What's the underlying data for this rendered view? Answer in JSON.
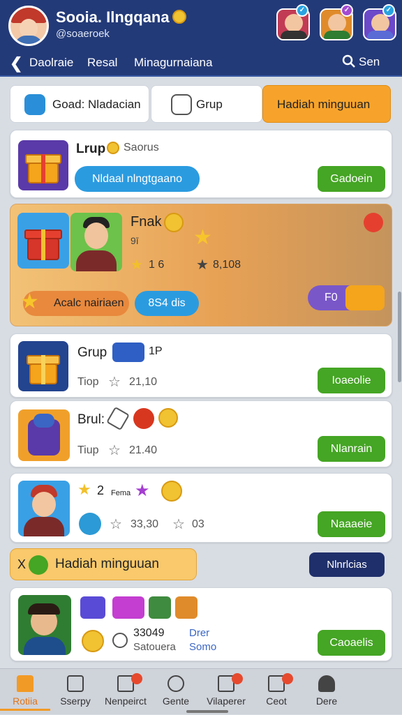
{
  "header": {
    "title": "Sooia. Ilngqana",
    "handle": "@soaeroek",
    "friend_badges": [
      "✓",
      "✓",
      "✓"
    ]
  },
  "nav": {
    "items": [
      "Daolraie",
      "Resal",
      "Minagurnaiana"
    ],
    "search_label": "Sen"
  },
  "tabs": [
    {
      "label": "Goad: Nladacian"
    },
    {
      "label": "Grup"
    },
    {
      "label": "Hadiah minguuan"
    }
  ],
  "card1": {
    "title": "Lrup",
    "meta": "Saorus",
    "pill": "Nldaal nlngtgaano",
    "button": "Gadoein"
  },
  "feature": {
    "title": "Fnak",
    "tag": "9ī",
    "stat1": "1 6",
    "stat2": "8,108",
    "action": "Acalc nairiaen",
    "pill": "8S4 dis",
    "side_label": "F0"
  },
  "card2": {
    "title": "Grup",
    "suffix": "1P",
    "meta": "Tiop",
    "value": "21,10",
    "button": "Ioaeolie"
  },
  "card3": {
    "title": "Brul:",
    "meta": "Tiup",
    "value": "21.40",
    "button": "Nlanrain"
  },
  "card4": {
    "count": "2",
    "tag": "Fema",
    "value1": "33,30",
    "value2": "03",
    "button": "Naaaeie"
  },
  "section": {
    "prefix": "X",
    "title": "Hadiah minguuan",
    "button": "Nlnrlcias"
  },
  "card5": {
    "value": "33049",
    "label": "Satouera",
    "side_top": "Drer",
    "side_bottom": "Somo",
    "button": "Caoaelis"
  },
  "bottom_nav": [
    {
      "label": "Rotiia",
      "badge": false
    },
    {
      "label": "Sserpy",
      "badge": false
    },
    {
      "label": "Nenpeirct",
      "badge": true
    },
    {
      "label": "Gente",
      "badge": false
    },
    {
      "label": "Vilaperer",
      "badge": true
    },
    {
      "label": "Ceot",
      "badge": true
    },
    {
      "label": "Dere",
      "badge": false
    }
  ],
  "colors": {
    "header": "#233a78",
    "accent_orange": "#f7a32b",
    "green_button": "#45a524",
    "blue_pill": "#2b9be0"
  }
}
